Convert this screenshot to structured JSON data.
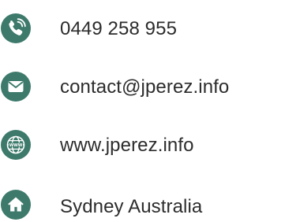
{
  "colors": {
    "icon_fill": "#3d7a6b",
    "icon_glyph": "#ffffff",
    "text": "#2c2c2c"
  },
  "contacts": [
    {
      "icon": "phone-icon",
      "text": "0449 258 955"
    },
    {
      "icon": "email-icon",
      "text": "contact@jperez.info"
    },
    {
      "icon": "globe-icon",
      "text": "www.jperez.info"
    },
    {
      "icon": "home-icon",
      "text": "Sydney Australia"
    }
  ]
}
